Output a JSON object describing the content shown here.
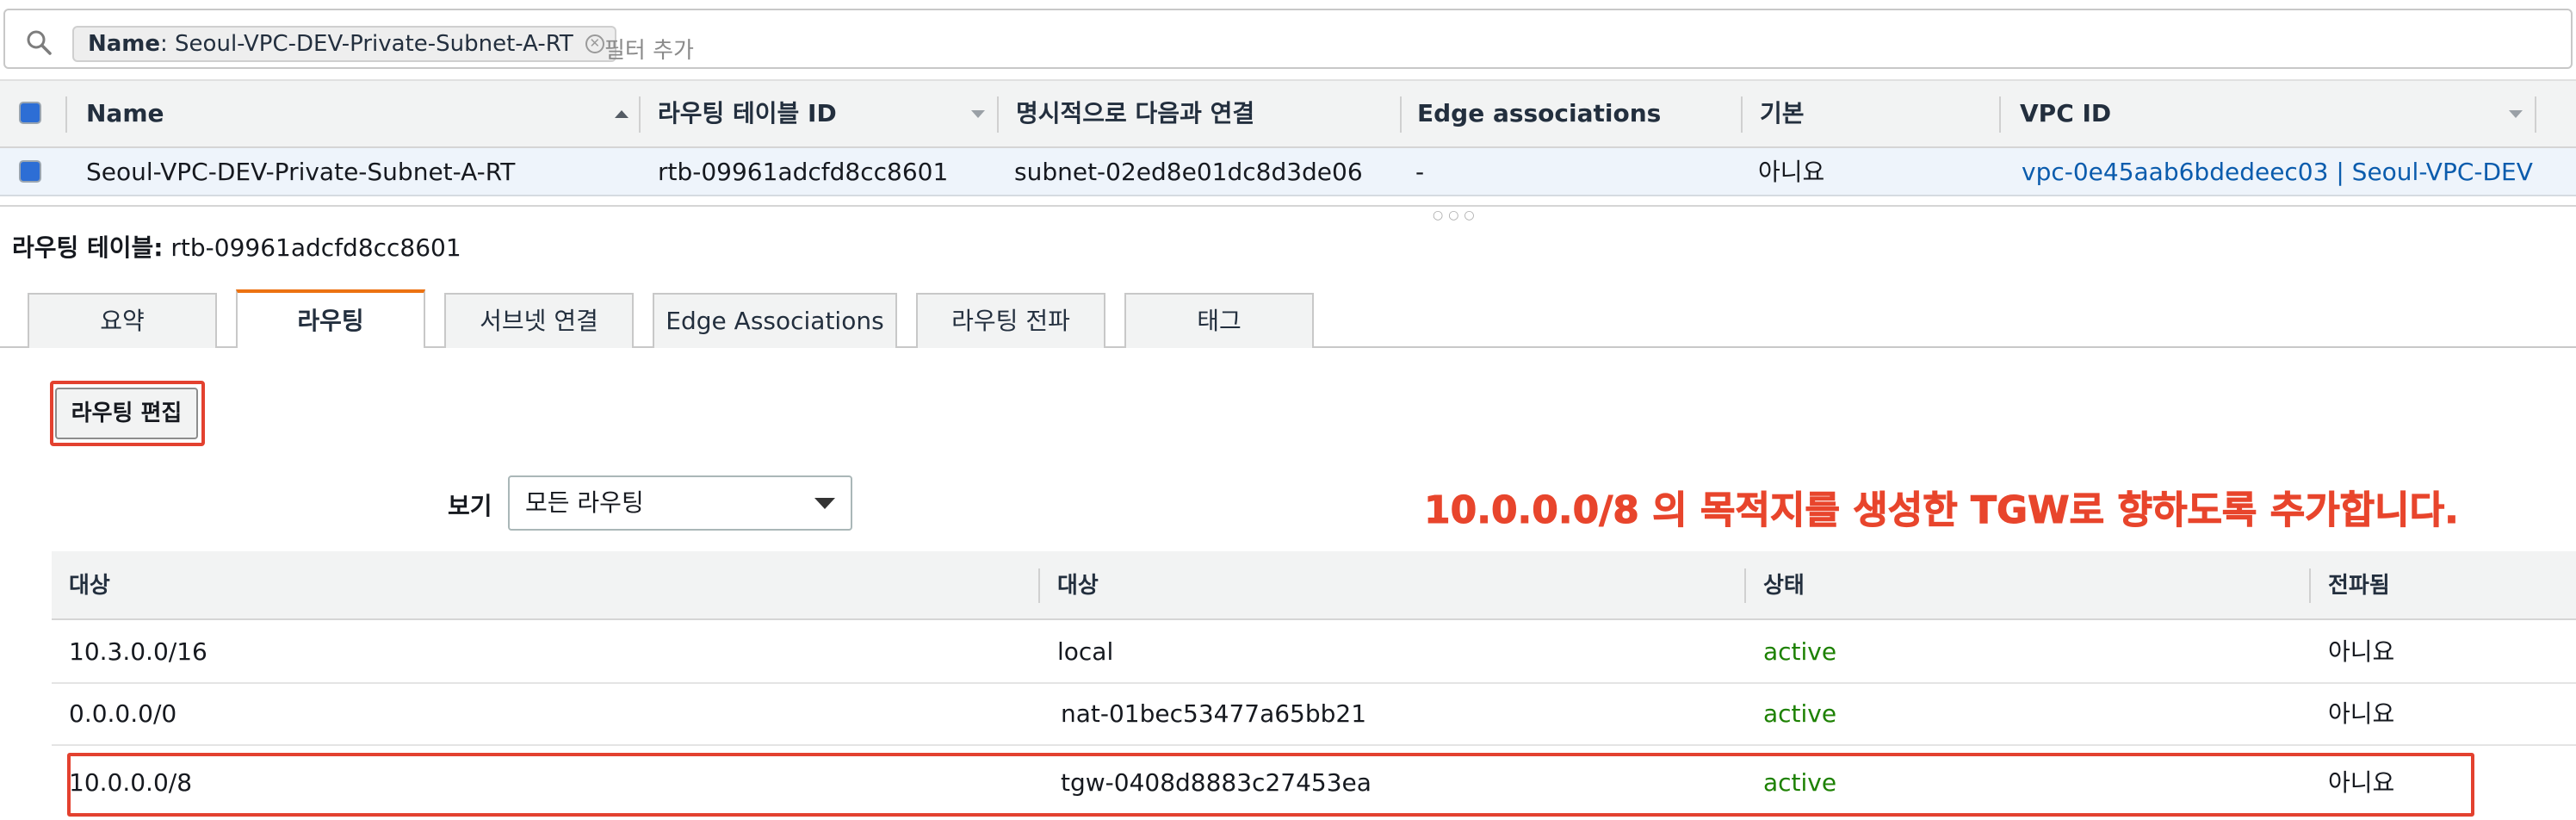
{
  "filter": {
    "token_key": "Name",
    "token_value": ": Seoul-VPC-DEV-Private-Subnet-A-RT",
    "placeholder": "필터 추가"
  },
  "grid": {
    "columns": [
      "Name",
      "라우팅 테이블 ID",
      "명시적으로 다음과 연결",
      "Edge associations",
      "기본",
      "VPC ID"
    ],
    "row": {
      "name": "Seoul-VPC-DEV-Private-Subnet-A-RT",
      "route_table_id": "rtb-09961adcfd8cc8601",
      "explicit_association": "subnet-02ed8e01dc8d3de06",
      "edge_associations": "-",
      "main": "아니요",
      "vpc_id": "vpc-0e45aab6bdedeec03 | Seoul-VPC-DEV"
    }
  },
  "detail": {
    "title_label": "라우팅 테이블:",
    "title_value": "rtb-09961adcfd8cc8601"
  },
  "tabs": [
    {
      "label": "요약",
      "active": false
    },
    {
      "label": "라우팅",
      "active": true
    },
    {
      "label": "서브넷 연결",
      "active": false
    },
    {
      "label": "Edge Associations",
      "active": false
    },
    {
      "label": "라우팅 전파",
      "active": false
    },
    {
      "label": "태그",
      "active": false
    }
  ],
  "routes": {
    "edit_button": "라우팅 편집",
    "view_label": "보기",
    "view_selected": "모든 라우팅",
    "columns": [
      "대상",
      "대상",
      "상태",
      "전파됨"
    ],
    "rows": [
      {
        "destination": "10.3.0.0/16",
        "target": "local",
        "status": "active",
        "propagated": "아니요",
        "target_is_link": false
      },
      {
        "destination": "0.0.0.0/0",
        "target": "nat-01bec53477a65bb21",
        "status": "active",
        "propagated": "아니요",
        "target_is_link": true
      },
      {
        "destination": "10.0.0.0/8",
        "target": "tgw-0408d8883c27453ea",
        "status": "active",
        "propagated": "아니요",
        "target_is_link": true
      }
    ]
  },
  "annotation": "10.0.0.0/8 의 목적지를 생성한 TGW로 향하도록 추가합니다.",
  "colors": {
    "highlight": "#e3412f",
    "active_status": "#1d8102",
    "link": "#0b5cad",
    "tab_accent": "#ec7211"
  }
}
